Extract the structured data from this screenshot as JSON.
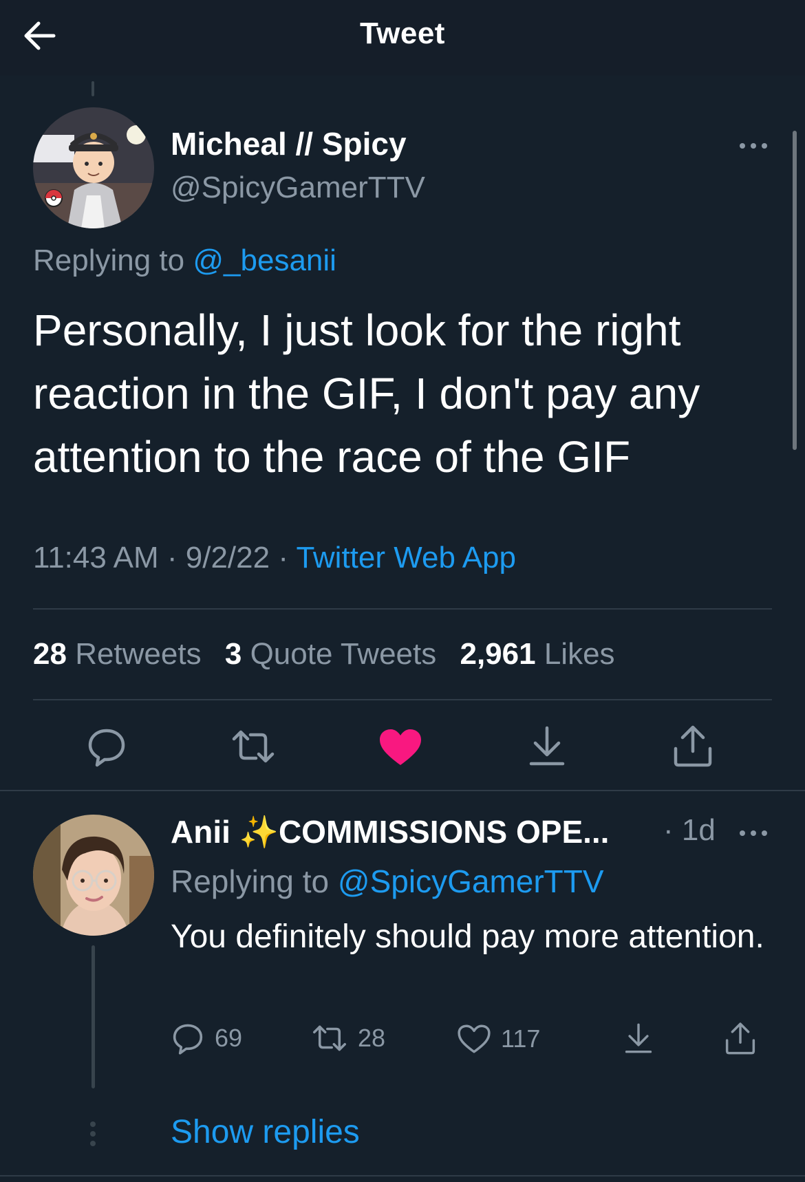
{
  "header": {
    "title": "Tweet"
  },
  "main_tweet": {
    "display_name": "Micheal // Spicy",
    "handle": "@SpicyGamerTTV",
    "replying_label": "Replying to",
    "replying_to": "@_besanii",
    "text": "Personally, I just look for the right reaction in the GIF, I don't pay any attention to the race of the GIF",
    "time": "11:43 AM",
    "date": "9/2/22",
    "source": "Twitter Web App",
    "stats": {
      "retweets_count": "28",
      "retweets_label": "Retweets",
      "quotes_count": "3",
      "quotes_label": "Quote Tweets",
      "likes_count": "2,961",
      "likes_label": "Likes"
    },
    "liked": true
  },
  "reply": {
    "display_name": "Anii",
    "name_suffix": "COMMISSIONS OPE...",
    "sparkle": "✨",
    "time": "· 1d",
    "replying_label": "Replying to",
    "replying_to": "@SpicyGamerTTV",
    "text": "You definitely should pay more attention.",
    "replies": "69",
    "retweets": "28",
    "likes": "117"
  },
  "show_replies_label": "Show replies",
  "colors": {
    "background": "#15202b",
    "accent": "#1d9bf0",
    "like": "#f91880",
    "muted": "#8b98a5"
  }
}
